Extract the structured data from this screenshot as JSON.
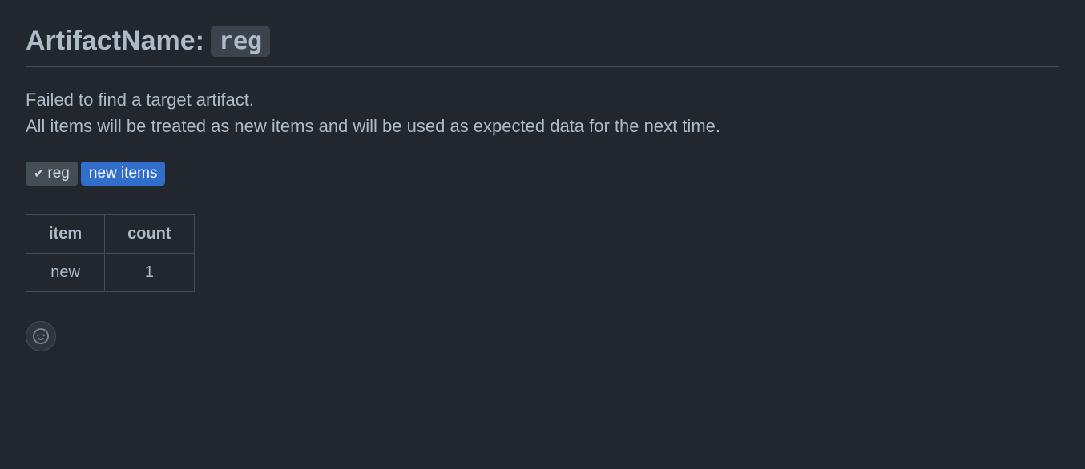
{
  "heading": {
    "label": "ArtifactName:",
    "code": "reg"
  },
  "message": {
    "line1": "Failed to find a target artifact.",
    "line2": "All items will be treated as new items and will be used as expected data for the next time."
  },
  "tags": [
    {
      "label": "reg",
      "variant": "gray",
      "checked": true
    },
    {
      "label": "new items",
      "variant": "blue",
      "checked": false
    }
  ],
  "table": {
    "headers": [
      "item",
      "count"
    ],
    "rows": [
      {
        "item": "new",
        "count": "1"
      }
    ]
  }
}
